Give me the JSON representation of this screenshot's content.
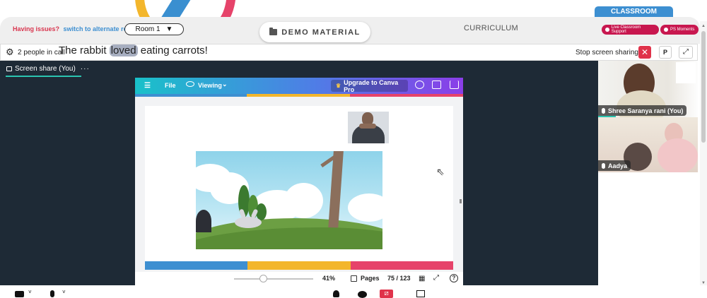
{
  "header": {
    "issues_text": "Having issues?",
    "alternate_link": "switch to alternate room",
    "room_select_value": "Room 1",
    "demo_material_label": "DEMO MATERIAL",
    "curriculum_label": "CURRICULUM",
    "classroom_tab": "CLASSROOM",
    "live_support_label": "Live Classroom Support",
    "ps_moments_label": "PS Moments"
  },
  "callbar": {
    "people_text": "2 people in call",
    "stop_sharing_label": "Stop screen sharing",
    "close_glyph": "✕",
    "p_label": "P",
    "expand_glyph": "⤢"
  },
  "share": {
    "label": "Screen share (You)",
    "more_glyph": "···"
  },
  "canva": {
    "menu_glyph": "☰",
    "file_label": "File",
    "viewing_label": "Viewing",
    "upgrade_label": "Upgrade to Canva Pro",
    "slide_title_before": "The rabbit ",
    "slide_title_highlight": "loved",
    "slide_title_after": " eating carrots!",
    "zoom_value": "41%",
    "pages_label": "Pages",
    "page_count": "75 / 123",
    "help_glyph": "?",
    "colors": {
      "blue": "#3d8fd1",
      "yellow": "#f3b62c",
      "red": "#e6436a"
    }
  },
  "participants": [
    {
      "name": "Shree Saranya rani (You)"
    },
    {
      "name": "Aadya"
    }
  ],
  "icons": [
    "gear-icon",
    "monitor-icon",
    "menu-icon",
    "eye-icon",
    "chevron-down-icon",
    "crown-icon",
    "people-icon",
    "present-icon",
    "share-out-icon",
    "pages-icon",
    "grid-icon",
    "fullscreen-icon",
    "help-icon",
    "mic-icon",
    "camera-icon",
    "person-icon",
    "chat-icon",
    "screen-share-icon",
    "layout-icon",
    "cursor-icon",
    "folder-icon"
  ]
}
